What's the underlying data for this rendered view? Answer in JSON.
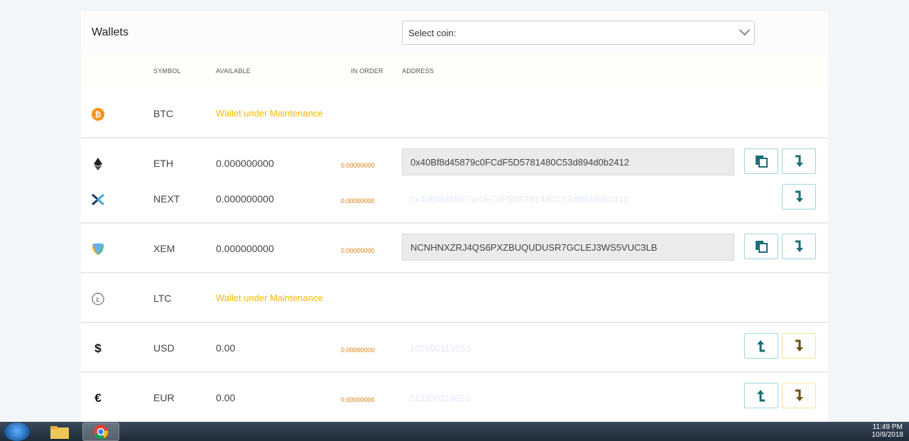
{
  "header": {
    "title": "Wallets",
    "select_placeholder": "Select coin:"
  },
  "columns": {
    "symbol": "SYMBOL",
    "available": "AVAILABLE",
    "in_order": "IN ORDER",
    "address": "ADDRESS"
  },
  "rows": [
    {
      "symbol": "BTC",
      "icon": "bitcoin-icon",
      "status": "Wallet under Maintenance"
    },
    {
      "symbol": "ETH",
      "icon": "ethereum-icon",
      "available": "0.000000000",
      "in_order": "0.00000000",
      "address": "0x40Bf8d45879c0FCdF5D5781480C53d894d0b2412"
    },
    {
      "symbol": "NEXT",
      "icon": "next-icon",
      "available": "0.000000000",
      "in_order": "0.00000000",
      "address": "0x40Bf8d45879c0FCdF5D5781480C53d894d0b2412"
    },
    {
      "symbol": "XEM",
      "icon": "nem-icon",
      "available": "0.000000000",
      "in_order": "0.00000000",
      "address": "NCNHNXZRJ4QS6PXZBUQUDUSR7GCLEJ3WS5VUC3LB"
    },
    {
      "symbol": "LTC",
      "icon": "litecoin-icon",
      "status": "Wallet under Maintenance"
    },
    {
      "symbol": "USD",
      "icon": "dollar-icon",
      "icon_glyph": "$",
      "available": "0.00",
      "in_order": "0.00000000",
      "address": "107000119653"
    },
    {
      "symbol": "EUR",
      "icon": "euro-icon",
      "icon_glyph": "€",
      "available": "0.00",
      "in_order": "0.00000000",
      "address": "113300119653"
    }
  ],
  "taskbar": {
    "time": "11:49 PM",
    "date": "10/9/2018"
  },
  "colors": {
    "accent": "#1a6f78",
    "maintenance": "#f5b800",
    "in_order": "#e07b0a"
  }
}
